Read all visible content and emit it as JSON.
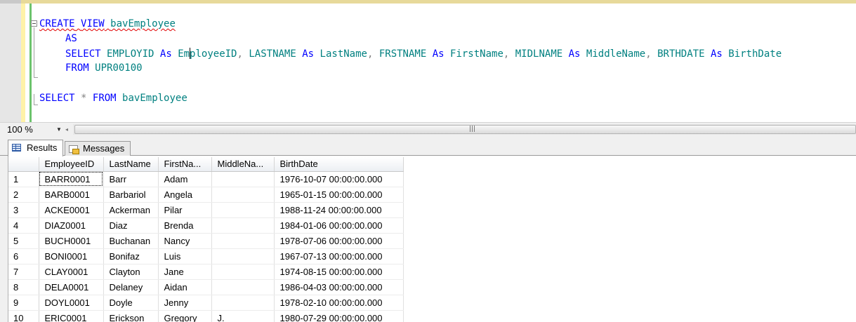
{
  "editor": {
    "lines": {
      "l1": {
        "create": "CREATE",
        "view": "VIEW",
        "name": "bavEmployee"
      },
      "l2": {
        "as": "AS"
      },
      "l3": {
        "select": "SELECT",
        "c1": "EMPLOYID",
        "as1": "As",
        "a1_pre": "Em",
        "a1_post": "ployeeID",
        "comma1": ",",
        "c2": "LASTNAME",
        "as2": "As",
        "a2": "LastName",
        "comma2": ",",
        "c3": "FRSTNAME",
        "as3": "As",
        "a3": "FirstName",
        "comma3": ",",
        "c4": "MIDLNAME",
        "as4": "As",
        "a4": "MiddleName",
        "comma4": ",",
        "c5": "BRTHDATE",
        "as5": "As",
        "a5": "BirthDate"
      },
      "l4": {
        "from": "FROM",
        "table": "UPR00100"
      },
      "l6": {
        "select": "SELECT",
        "star": "*",
        "from": "FROM",
        "name": "bavEmployee"
      }
    }
  },
  "zoom": {
    "value": "100 %"
  },
  "tabs": [
    {
      "label": "Results",
      "icon": "grid-icon"
    },
    {
      "label": "Messages",
      "icon": "messages-icon"
    }
  ],
  "grid": {
    "columns": [
      "EmployeeID",
      "LastName",
      "FirstNa...",
      "MiddleNa...",
      "BirthDate"
    ],
    "rows": [
      {
        "n": "1",
        "id": "BARR0001",
        "last": "Barr",
        "first": "Adam",
        "middle": "",
        "birth": "1976-10-07 00:00:00.000"
      },
      {
        "n": "2",
        "id": "BARB0001",
        "last": "Barbariol",
        "first": "Angela",
        "middle": "",
        "birth": "1965-01-15 00:00:00.000"
      },
      {
        "n": "3",
        "id": "ACKE0001",
        "last": "Ackerman",
        "first": "Pilar",
        "middle": "",
        "birth": "1988-11-24 00:00:00.000"
      },
      {
        "n": "4",
        "id": "DIAZ0001",
        "last": "Diaz",
        "first": "Brenda",
        "middle": "",
        "birth": "1984-01-06 00:00:00.000"
      },
      {
        "n": "5",
        "id": "BUCH0001",
        "last": "Buchanan",
        "first": "Nancy",
        "middle": "",
        "birth": "1978-07-06 00:00:00.000"
      },
      {
        "n": "6",
        "id": "BONI0001",
        "last": "Bonifaz",
        "first": "Luis",
        "middle": "",
        "birth": "1967-07-13 00:00:00.000"
      },
      {
        "n": "7",
        "id": "CLAY0001",
        "last": "Clayton",
        "first": "Jane",
        "middle": "",
        "birth": "1974-08-15 00:00:00.000"
      },
      {
        "n": "8",
        "id": "DELA0001",
        "last": "Delaney",
        "first": "Aidan",
        "middle": "",
        "birth": "1986-04-03 00:00:00.000"
      },
      {
        "n": "9",
        "id": "DOYL0001",
        "last": "Doyle",
        "first": "Jenny",
        "middle": "",
        "birth": "1978-02-10 00:00:00.000"
      },
      {
        "n": "10",
        "id": "ERIC0001",
        "last": "Erickson",
        "first": "Gregory",
        "middle": "J.",
        "birth": "1980-07-29 00:00:00.000"
      }
    ]
  },
  "colors": {
    "keyword": "#0000ff",
    "identifier": "#008080",
    "operator": "#808080",
    "squiggle": "#e00000"
  }
}
